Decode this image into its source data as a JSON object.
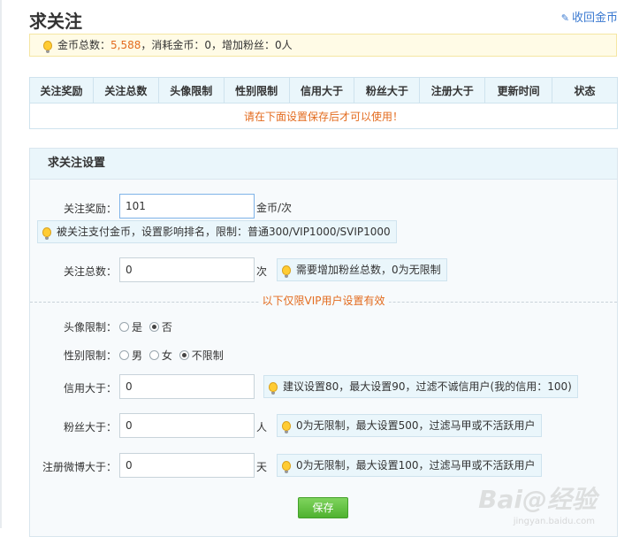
{
  "page": {
    "title": "求关注"
  },
  "header": {
    "withdraw_label": "收回金币"
  },
  "summary": {
    "prefix": "金币总数：",
    "total_coins": "5,588",
    "rest": "，消耗金币：0，增加粉丝：0人"
  },
  "table": {
    "headers": [
      "关注奖励",
      "关注总数",
      "头像限制",
      "性别限制",
      "信用大于",
      "粉丝大于",
      "注册大于",
      "更新时间",
      "状态"
    ],
    "empty_message": "请在下面设置保存后才可以使用！"
  },
  "settings": {
    "title": "求关注设置",
    "reward": {
      "label": "关注奖励：",
      "value": "101",
      "unit": "金币/次",
      "tip": "被关注支付金币，设置影响排名，限制：普通300/VIP1000/SVIP1000"
    },
    "total": {
      "label": "关注总数：",
      "value": "0",
      "unit": "次",
      "tip": "需要增加粉丝总数，0为无限制"
    },
    "vip_note": "以下仅限VIP用户设置有效",
    "avatar": {
      "label": "头像限制：",
      "options": [
        "是",
        "否"
      ],
      "selected": "否"
    },
    "gender": {
      "label": "性别限制：",
      "options": [
        "男",
        "女",
        "不限制"
      ],
      "selected": "不限制"
    },
    "credit": {
      "label": "信用大于：",
      "value": "0",
      "tip": "建议设置80，最大设置90，过滤不诚信用户(我的信用：100)"
    },
    "fans": {
      "label": "粉丝大于：",
      "value": "0",
      "unit": "人",
      "tip": "0为无限制，最大设置500，过滤马甲或不活跃用户"
    },
    "register": {
      "label": "注册微博大于：",
      "value": "0",
      "unit": "天",
      "tip": "0为无限制，最大设置100，过滤马甲或不活跃用户"
    },
    "save_label": "保存"
  },
  "watermark": {
    "text": "Bai@经验",
    "sub": "jingyan.baidu.com"
  },
  "colors": {
    "accent_link": "#3b7ad1",
    "highlight": "#e36b1e",
    "save_green": "#4fb22f"
  },
  "icons": {
    "tip": "lightbulb-icon",
    "link": "refresh-icon"
  }
}
